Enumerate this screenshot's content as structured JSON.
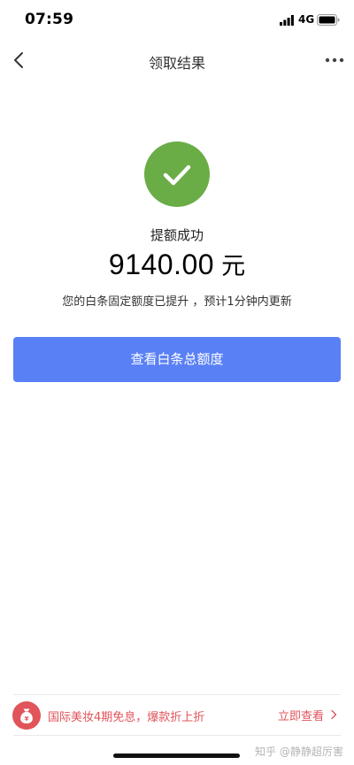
{
  "status_bar": {
    "time": "07:59",
    "network": "4G",
    "signal_icon": "cellular-signal-icon",
    "battery_icon": "battery-icon"
  },
  "nav": {
    "title": "领取结果",
    "back_icon": "chevron-left-icon",
    "more_icon": "more-dots-icon"
  },
  "result": {
    "icon": "check-circle-icon",
    "icon_color": "#6aac46",
    "title": "提额成功",
    "amount": "9140.00",
    "unit": "元",
    "description": "您的白条固定额度已提升 ，预计1分钟内更新"
  },
  "primary_button": {
    "label": "查看白条总额度",
    "color": "#5a80f6"
  },
  "promo": {
    "icon": "money-bag-icon",
    "text": "国际美妆4期免息，爆款折上折",
    "link_label": "立即查看",
    "chevron_icon": "chevron-right-icon",
    "color": "#e0545a"
  },
  "watermark": "知乎 @静静超厉害"
}
